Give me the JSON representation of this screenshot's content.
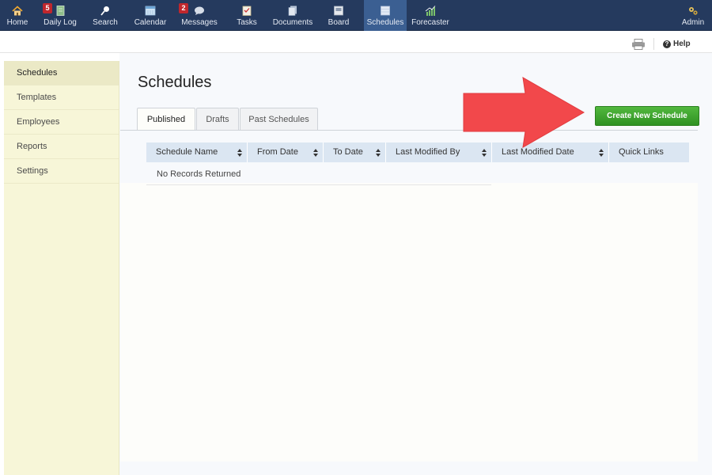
{
  "nav": {
    "home": "Home",
    "daily_log": "Daily Log",
    "daily_log_badge": "5",
    "search": "Search",
    "calendar": "Calendar",
    "messages": "Messages",
    "messages_badge": "2",
    "tasks": "Tasks",
    "documents": "Documents",
    "board": "Board",
    "schedules": "Schedules",
    "forecaster": "Forecaster",
    "admin": "Admin",
    "active": "Schedules"
  },
  "toolbar": {
    "help_label": "Help",
    "help_icon": "?"
  },
  "sidebar": {
    "items": [
      {
        "label": "Schedules",
        "active": true
      },
      {
        "label": "Templates",
        "active": false
      },
      {
        "label": "Employees",
        "active": false
      },
      {
        "label": "Reports",
        "active": false
      },
      {
        "label": "Settings",
        "active": false
      }
    ]
  },
  "main": {
    "title": "Schedules",
    "tabs": [
      {
        "label": "Published",
        "active": true
      },
      {
        "label": "Drafts",
        "active": false
      },
      {
        "label": "Past Schedules",
        "active": false
      }
    ],
    "create_button": "Create New Schedule"
  },
  "table": {
    "columns": [
      "Schedule Name",
      "From Date",
      "To Date",
      "Last Modified By",
      "Last Modified Date",
      "Quick Links"
    ],
    "empty_message": "No Records Returned"
  },
  "colors": {
    "nav_bg": "#253a5e",
    "nav_active": "#3b5f92",
    "sidebar_bg": "#f7f6d8",
    "create_button": "#3da42c",
    "table_header": "#dbe6f2",
    "badge": "#c0272d",
    "arrow": "#f2484b"
  }
}
